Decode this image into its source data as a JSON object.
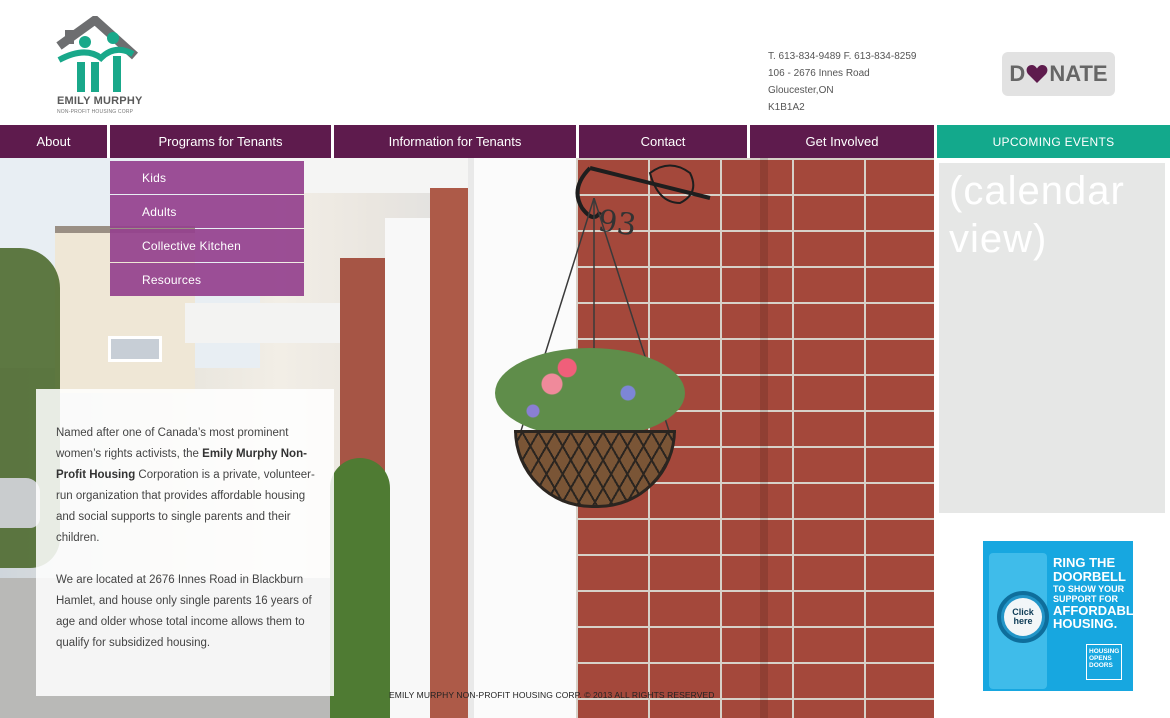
{
  "brand": {
    "name": "EMILY MURPHY",
    "sub": "NON-PROFIT HOUSING CORP",
    "colors": {
      "roof": "#6d6e70",
      "figure_teal": "#19a88a",
      "nav_purple": "#5e1b4d",
      "dropdown_purple": "#94428e",
      "events_green": "#13a98c"
    }
  },
  "contact": {
    "phone": "T. 613-834-9489 F. 613-834-8259",
    "street": "106 - 2676 Innes Road",
    "city": "Gloucester,ON",
    "postal": "K1B1A2"
  },
  "donate": {
    "before": "D",
    "after": "NATE",
    "heart_icon": "heart-icon",
    "heart_color": "#5e1b4d"
  },
  "nav": {
    "about": "About",
    "programs": "Programs for Tenants",
    "information": "Information for Tenants",
    "contact": "Contact",
    "involved": "Get Involved"
  },
  "events": {
    "heading": "UPCOMING EVENTS",
    "calendar_placeholder": "(calendar\nview)"
  },
  "dropdown": {
    "items": [
      "Kids",
      "Adults",
      "Collective Kitchen",
      "Resources"
    ]
  },
  "intro": {
    "p1_a": "Named after one of Canada’s most prominent women’s rights activists, the ",
    "p1_strong": "Emily Murphy Non-Profit Housing",
    "p1_b": " Corporation is a private, volunteer-run organization that provides affordable housing and social supports to single parents and their children.",
    "p2": "We are located at 2676 Innes Road in Blackburn Hamlet, and house only single parents 16 years of age and older whose total income allows them to qualify for subsidized housing."
  },
  "house_number": "93",
  "footer": "EMILY MURPHY NON-PROFIT HOUSING CORP. © 2013 ALL RIGHTS RESERVED",
  "ad": {
    "line1": "RING THE",
    "line2": "DOORBELL",
    "line3": "TO SHOW YOUR",
    "line4": "SUPPORT FOR",
    "line5": "AFFORDABLE",
    "line6": "HOUSING.",
    "button_line1": "Click",
    "button_line2": "here",
    "badge_line1": "HOUSING",
    "badge_line2": "OPENS",
    "badge_line3": "DOORS",
    "color": "#17a7e0"
  }
}
